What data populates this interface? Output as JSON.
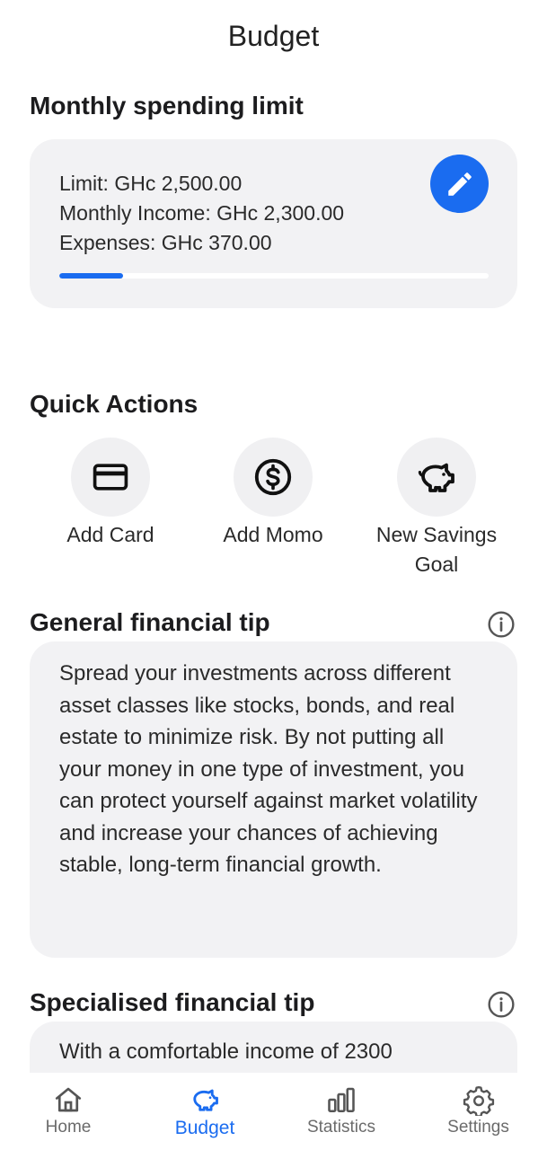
{
  "header": {
    "title": "Budget"
  },
  "spending_limit": {
    "title": "Monthly spending limit",
    "limit_text": "Limit: GHc 2,500.00",
    "income_text": "Monthly Income: GHc 2,300.00",
    "expenses_text": "Expenses: GHc 370.00",
    "progress_fraction": 0.148,
    "accent_color": "#1a6cf0",
    "edit_icon": "pencil-icon"
  },
  "quick_actions": {
    "title": "Quick Actions",
    "items": [
      {
        "label": "Add Card",
        "icon": "credit-card-icon"
      },
      {
        "label": "Add Momo",
        "icon": "dollar-circle-icon"
      },
      {
        "label": "New Savings Goal",
        "icon": "piggy-bank-icon"
      }
    ]
  },
  "general_tip": {
    "title": "General financial tip",
    "text": "Spread your investments across different asset classes like stocks, bonds, and real estate to minimize risk. By not putting all your money in one type of investment, you can protect yourself against market volatility and increase your chances of achieving stable, long-term financial growth.",
    "icon": "info-icon"
  },
  "specialised_tip": {
    "title": "Specialised financial tip",
    "text": "With a comfortable income of 2300",
    "icon": "info-icon"
  },
  "bottom_nav": {
    "items": [
      {
        "label": "Home",
        "icon": "home-icon",
        "active": false
      },
      {
        "label": "Budget",
        "icon": "piggy-bank-icon",
        "active": true
      },
      {
        "label": "Statistics",
        "icon": "bar-chart-icon",
        "active": false
      },
      {
        "label": "Settings",
        "icon": "gear-icon",
        "active": false
      }
    ]
  }
}
